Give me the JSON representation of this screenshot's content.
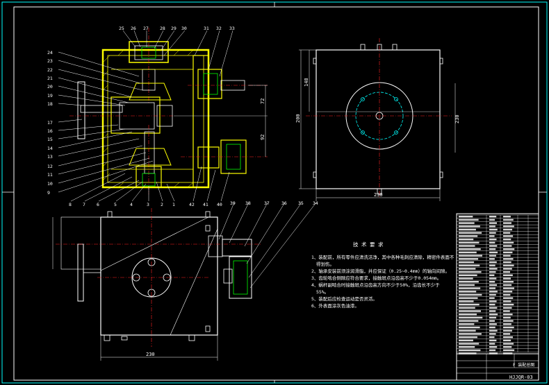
{
  "drawing": {
    "number": "HJJQR-03",
    "title_text": "F 装配总图",
    "colors": {
      "background": "#000000",
      "outline": "#ffffff",
      "section": "#ffff00",
      "hatch": "#ffff00",
      "centerline": "#ff2020",
      "hidden": "#00ffff",
      "dimension": "#ffffff",
      "highlight": "#00ff00"
    }
  },
  "views": {
    "front_section": {
      "top_labels": [
        "25",
        "26",
        "27",
        "28",
        "29",
        "30",
        "31",
        "32",
        "33"
      ],
      "left_labels": [
        "24",
        "23",
        "22",
        "21",
        "20",
        "19",
        "18",
        "17",
        "16",
        "15",
        "14",
        "13",
        "12",
        "11",
        "10",
        "9"
      ],
      "bottom_labels": [
        "8",
        "7",
        "6",
        "5",
        "4",
        "3",
        "2",
        "1",
        "42",
        "41",
        "40"
      ],
      "dims": [
        "72",
        "92"
      ]
    },
    "side_view": {
      "dims": [
        "148",
        "200",
        "230",
        "230"
      ]
    },
    "top_view": {
      "labels": [
        "39",
        "38",
        "37",
        "36",
        "35",
        "34"
      ],
      "dims": [
        "230"
      ]
    }
  },
  "notes": {
    "heading": "技 术 要 求",
    "items": [
      "1、装配前，所有零件应清洗洁净，其中各种毛刺应清除，精密件表面不",
      "得划伤。",
      "2、轴承安装前须涂润滑脂，并应保证（0.25~0.4mm）的轴向间隙。",
      "3、齿轮啮合侧隙应符合要求，接触斑点沿齿高不少于0.054mm。",
      "4、蜗杆副啮合时接触斑点沿齿高方向不少于50%，沿齿长不少于",
      "55%。",
      "5、装配后应检查运动是否灵活。",
      "6、外表面涂灰色油漆。"
    ]
  }
}
